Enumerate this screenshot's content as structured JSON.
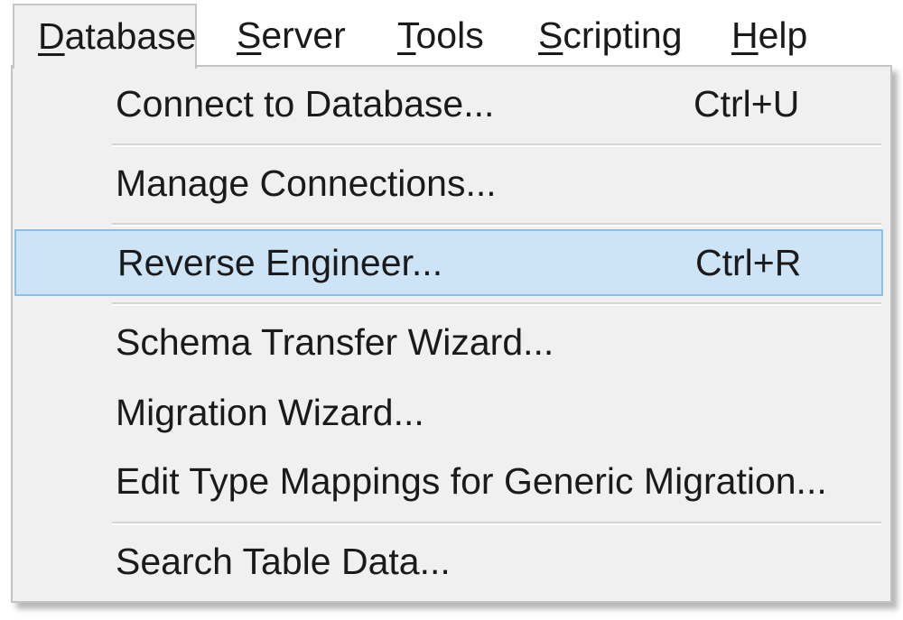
{
  "menubar": {
    "items": [
      {
        "prefix": "",
        "mnemonic": "D",
        "rest": "atabase"
      },
      {
        "prefix": "",
        "mnemonic": "S",
        "rest": "erver"
      },
      {
        "prefix": "",
        "mnemonic": "T",
        "rest": "ools"
      },
      {
        "prefix": "",
        "mnemonic": "S",
        "rest": "cripting"
      },
      {
        "prefix": "",
        "mnemonic": "H",
        "rest": "elp"
      }
    ]
  },
  "dropdown": {
    "items": [
      {
        "label": "Connect to Database...",
        "shortcut": "Ctrl+U"
      },
      {
        "label": "Manage Connections...",
        "shortcut": ""
      },
      {
        "label": "Reverse Engineer...",
        "shortcut": "Ctrl+R"
      },
      {
        "label": "Schema Transfer Wizard...",
        "shortcut": ""
      },
      {
        "label": "Migration Wizard...",
        "shortcut": ""
      },
      {
        "label": "Edit Type Mappings for Generic Migration...",
        "shortcut": ""
      },
      {
        "label": "Search Table Data...",
        "shortcut": ""
      }
    ],
    "highlighted_index": 2
  },
  "colors": {
    "menu_background": "#f0f0f0",
    "highlight_fill": "#cde4f7",
    "highlight_border": "#8cbfe6",
    "text": "#1a1a1a"
  }
}
